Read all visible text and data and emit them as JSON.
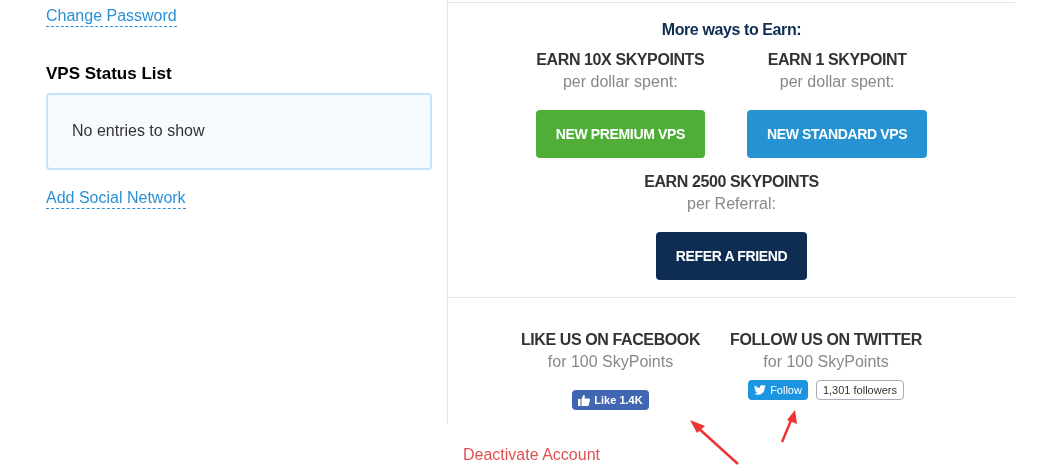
{
  "left": {
    "change_password": "Change Password",
    "vps_title": "VPS Status List",
    "vps_empty": "No entries to show",
    "add_social": "Add Social Network"
  },
  "earn": {
    "title": "More ways to Earn:",
    "offers": [
      {
        "heading": "EARN 10X SKYPOINTS",
        "sub": "per dollar spent:",
        "button": "NEW PREMIUM VPS",
        "color": "#4fad38"
      },
      {
        "heading": "EARN 1 SKYPOINT",
        "sub": "per dollar spent:",
        "button": "NEW STANDARD VPS",
        "color": "#2792d2"
      }
    ],
    "referral": {
      "heading": "EARN 2500 SKYPOINTS",
      "sub": "per Referral:",
      "button": "REFER A FRIEND",
      "color": "#0f2d52"
    }
  },
  "social": [
    {
      "kind": "facebook",
      "heading": "LIKE US ON FACEBOOK",
      "sub": "for 100 SkyPoints",
      "button": "Like",
      "count": "1.4K"
    },
    {
      "kind": "twitter",
      "heading": "FOLLOW US ON TWITTER",
      "sub": "for 100 SkyPoints",
      "button": "Follow",
      "count": "1,301 followers"
    }
  ],
  "deactivate": "Deactivate Account"
}
